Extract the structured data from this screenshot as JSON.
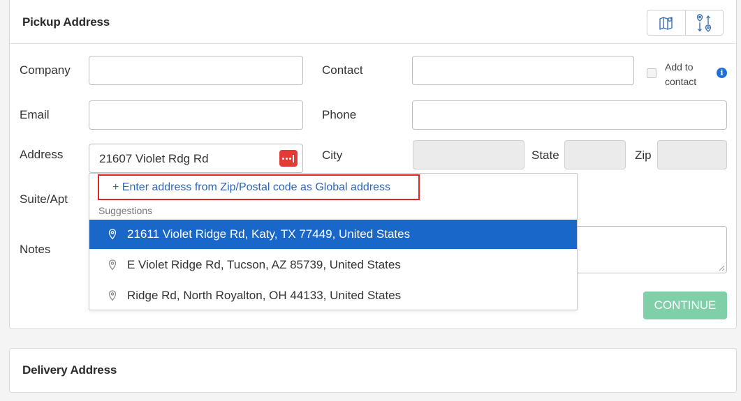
{
  "pickup": {
    "title": "Pickup Address",
    "header_buttons": [
      {
        "icon": "map-icon"
      },
      {
        "icon": "route-swap-icon"
      }
    ],
    "labels": {
      "company": "Company",
      "contact": "Contact",
      "email": "Email",
      "phone": "Phone",
      "address": "Address",
      "city": "City",
      "state": "State",
      "zip": "Zip",
      "suite": "Suite/Apt",
      "notes": "Notes"
    },
    "values": {
      "company": "",
      "contact": "",
      "email": "",
      "phone": "",
      "address": "21607 Violet Rdg Rd",
      "city": "",
      "state": "",
      "zip": ""
    },
    "add_to_contact": "Add to contact",
    "add_to_contact_checked": false,
    "continue_label": "CONTINUE"
  },
  "autocomplete": {
    "global_link": "+ Enter address from Zip/Postal code as Global address",
    "suggestions_header": "Suggestions",
    "suggestions": [
      {
        "label": "21611 Violet Ridge Rd, Katy, TX 77449, United States",
        "active": true
      },
      {
        "label": "E Violet Ridge Rd, Tucson, AZ 85739, United States",
        "active": false
      },
      {
        "label": "Ridge Rd, North Royalton, OH 44133, United States",
        "active": false
      }
    ]
  },
  "delivery": {
    "title": "Delivery Address"
  },
  "colors": {
    "accent_blue": "#1967c9",
    "link_blue": "#2c67b8",
    "highlight_red": "#e02424",
    "continue_green": "#7fcfa8",
    "badge_red": "#e53935"
  }
}
